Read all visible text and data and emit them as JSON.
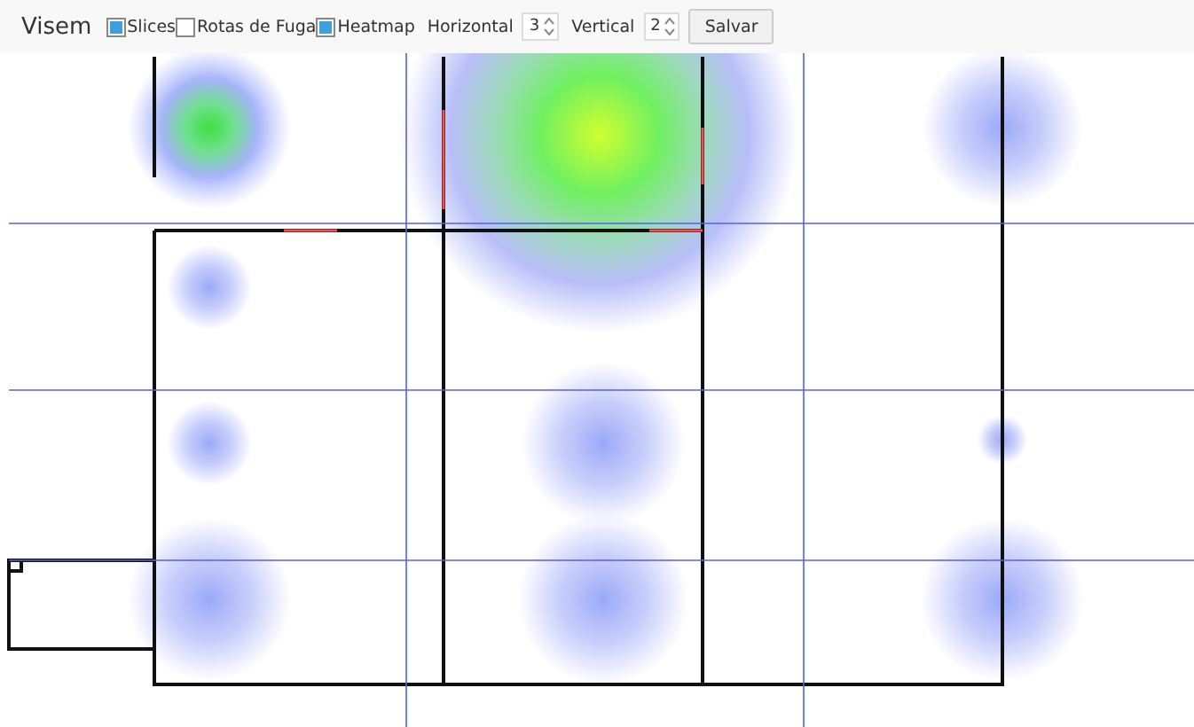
{
  "title": "Visem",
  "toggles": [
    {
      "label": "Slices",
      "checked": true
    },
    {
      "label": "Rotas de Fuga",
      "checked": false
    },
    {
      "label": "Heatmap",
      "checked": true
    }
  ],
  "spinners": [
    {
      "label": "Horizontal",
      "value": "3"
    },
    {
      "label": "Vertical",
      "value": "2"
    }
  ],
  "save_button": "Salvar"
}
